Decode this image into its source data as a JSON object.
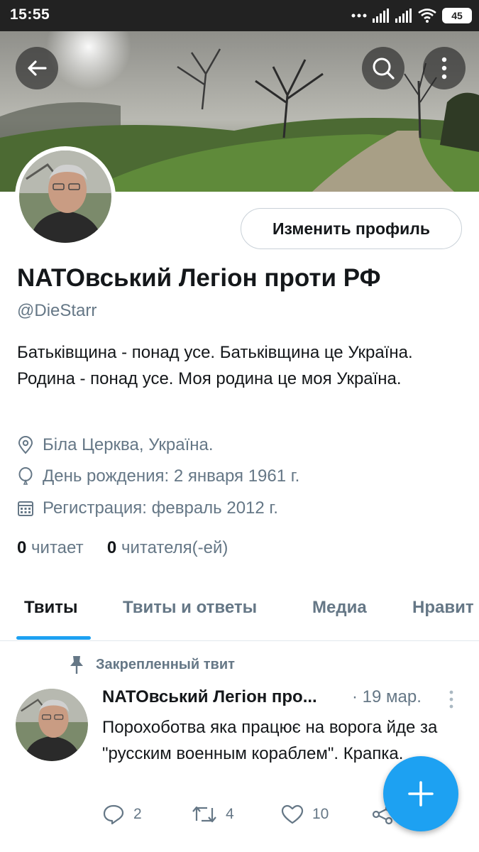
{
  "status_bar": {
    "time": "15:55",
    "battery": "45"
  },
  "profile": {
    "edit_button_label": "Изменить профиль",
    "display_name": "NATOвський Легіон проти РФ",
    "handle": "@DieStarr",
    "bio": "Батьківщина - понад усе. Батьківщина це Україна. Родина - понад усе. Моя родина це моя Україна.",
    "location": "Біла Церква, Україна.",
    "birthday": "День рождения: 2 января 1961 г.",
    "joined": "Регистрация: февраль 2012 г.",
    "following_count": "0",
    "following_label": "читает",
    "followers_count": "0",
    "followers_label": "читателя(-ей)"
  },
  "tabs": [
    {
      "label": "Твиты",
      "active": true
    },
    {
      "label": "Твиты и ответы",
      "active": false
    },
    {
      "label": "Медиа",
      "active": false
    },
    {
      "label": "Нравит",
      "active": false
    }
  ],
  "pinned_tweet": {
    "pinned_label": "Закрепленный твит",
    "author_name": "NATOвський Легіон про...",
    "date": "· 19 мар.",
    "text": "Порохоботва яка працює на ворога йде за \"русским военным кораблем\". Крапка.",
    "replies": "2",
    "retweets": "4",
    "likes": "10"
  },
  "icons": {
    "back": "arrow-left-icon",
    "search": "search-icon",
    "more": "more-vertical-icon",
    "location": "location-pin-icon",
    "birthday": "balloon-icon",
    "calendar": "calendar-icon",
    "pin": "pin-icon",
    "reply": "reply-icon",
    "retweet": "retweet-icon",
    "like": "heart-icon",
    "share": "share-icon",
    "compose": "plus-icon"
  },
  "colors": {
    "accent": "#1da1f2",
    "secondary_text": "#657786",
    "primary_text": "#14171a"
  }
}
